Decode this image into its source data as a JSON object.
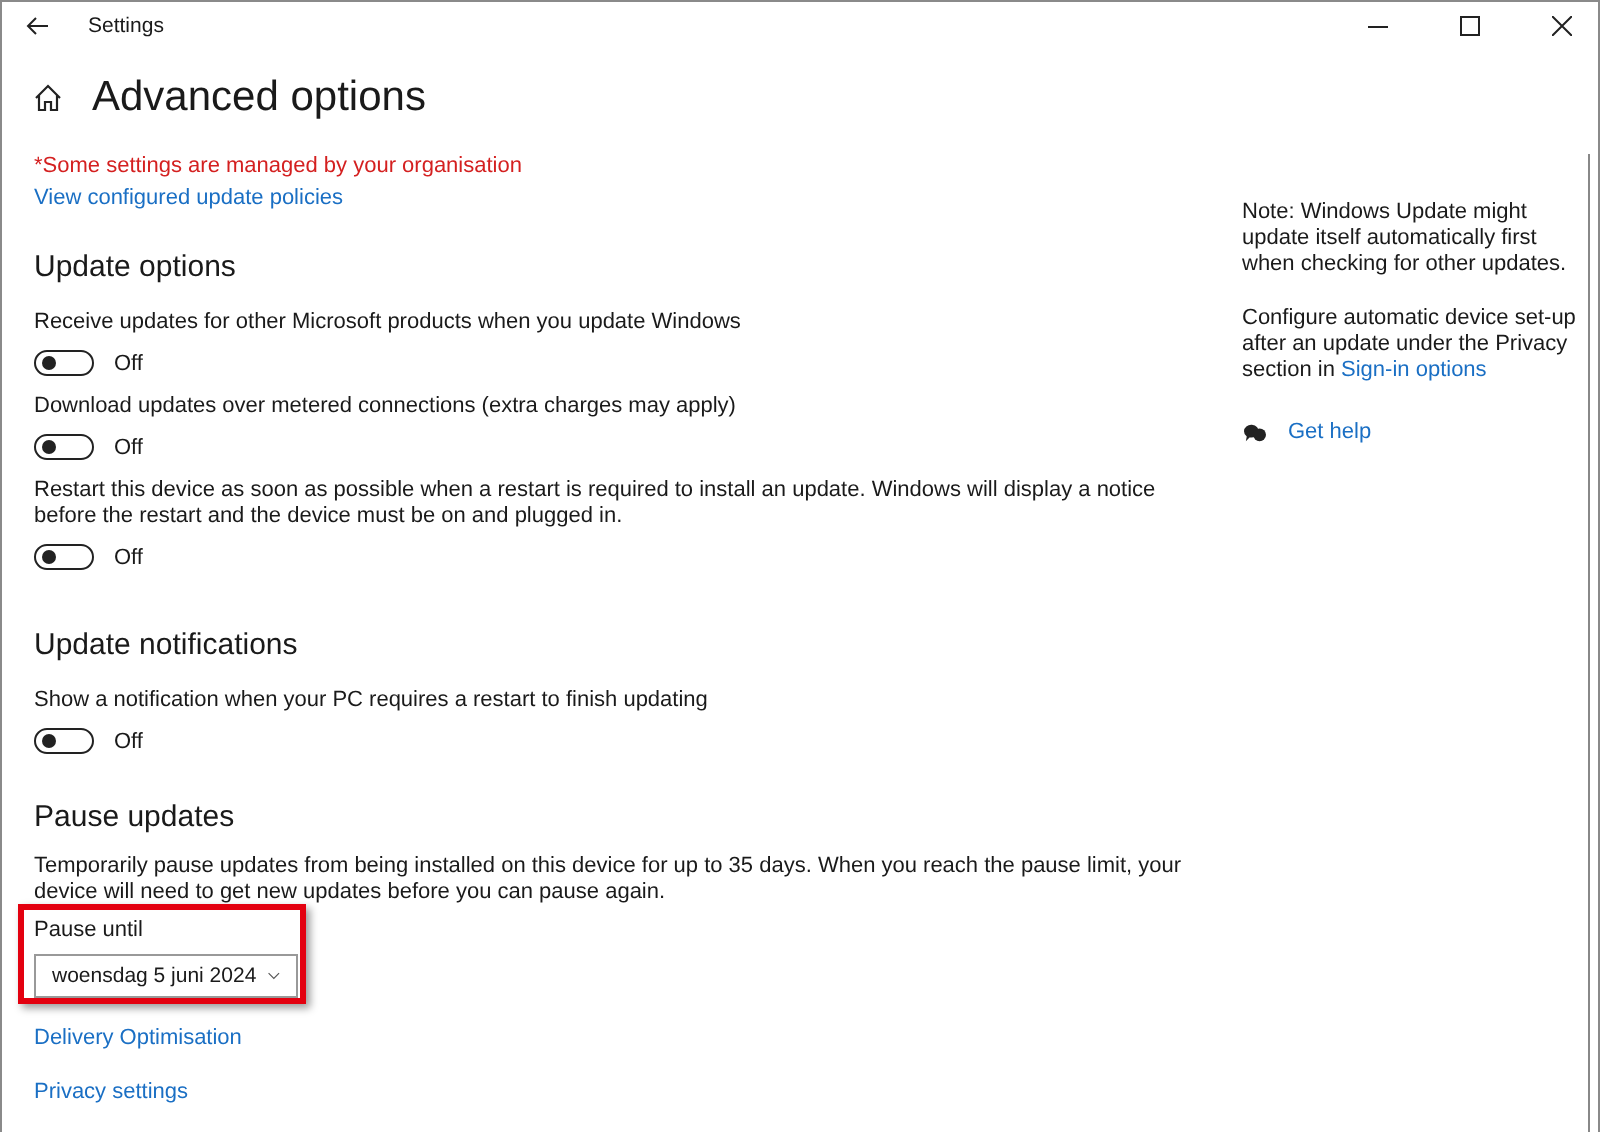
{
  "window": {
    "title": "Settings"
  },
  "page": {
    "heading": "Advanced options",
    "managed_notice": "*Some settings are managed by your organisation",
    "policies_link": "View configured update policies"
  },
  "sections": [
    {
      "title": "Update options",
      "toggles": [
        {
          "label": "Receive updates for other Microsoft products when you update Windows",
          "on": false,
          "state_label": "Off"
        },
        {
          "label": "Download updates over metered connections (extra charges may apply)",
          "on": false,
          "state_label": "Off"
        },
        {
          "label": "Restart this device as soon as possible when a restart is required to install an update. Windows will display a notice before the restart and the device must be on and plugged in.",
          "on": false,
          "state_label": "Off"
        }
      ]
    },
    {
      "title": "Update notifications",
      "toggles": [
        {
          "label": "Show a notification when your PC requires a restart to finish updating",
          "on": false,
          "state_label": "Off"
        }
      ]
    }
  ],
  "pause": {
    "title": "Pause updates",
    "description": "Temporarily pause updates from being installed on this device for up to 35 days. When you reach the pause limit, your device will need to get new updates before you can pause again.",
    "field_label": "Pause until",
    "value": "woensdag 5 juni 2024",
    "highlighted": true
  },
  "links": [
    "Delivery Optimisation",
    "Privacy settings"
  ],
  "side": {
    "note": "Note: Windows Update might update itself automatically first when checking for other updates.",
    "configure_text": "Configure automatic device set-up after an update under the Privacy section in",
    "configure_link": "Sign-in options",
    "help": "Get help"
  }
}
